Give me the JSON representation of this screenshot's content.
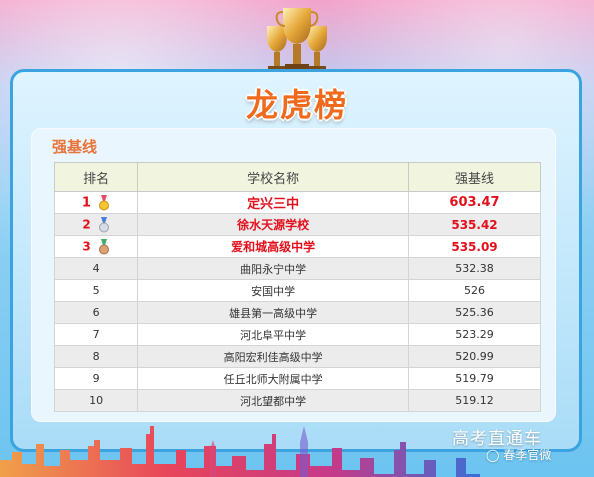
{
  "banner": {
    "title": "龙虎榜"
  },
  "section": {
    "title": "强基线"
  },
  "table": {
    "headers": [
      "排名",
      "学校名称",
      "强基线"
    ],
    "rows": [
      {
        "rank": "1",
        "school": "定兴三中",
        "score": "603.47",
        "medal": "gold"
      },
      {
        "rank": "2",
        "school": "徐水天源学校",
        "score": "535.42",
        "medal": "silver"
      },
      {
        "rank": "3",
        "school": "爱和城高级中学",
        "score": "535.09",
        "medal": "bronze"
      },
      {
        "rank": "4",
        "school": "曲阳永宁中学",
        "score": "532.38"
      },
      {
        "rank": "5",
        "school": "安国中学",
        "score": "526"
      },
      {
        "rank": "6",
        "school": "雄县第一高级中学",
        "score": "525.36"
      },
      {
        "rank": "7",
        "school": "河北阜平中学",
        "score": "523.29"
      },
      {
        "rank": "8",
        "school": "高阳宏利佳高级中学",
        "score": "520.99"
      },
      {
        "rank": "9",
        "school": "任丘北师大附属中学",
        "score": "519.79"
      },
      {
        "rank": "10",
        "school": "河北望都中学",
        "score": "519.12"
      }
    ]
  },
  "watermark": {
    "line1": "高考直通车",
    "line2": "春季官微"
  },
  "colors": {
    "accent": "#f06a1e",
    "highlight": "#e3101c",
    "frame": "#3aa3e0"
  }
}
